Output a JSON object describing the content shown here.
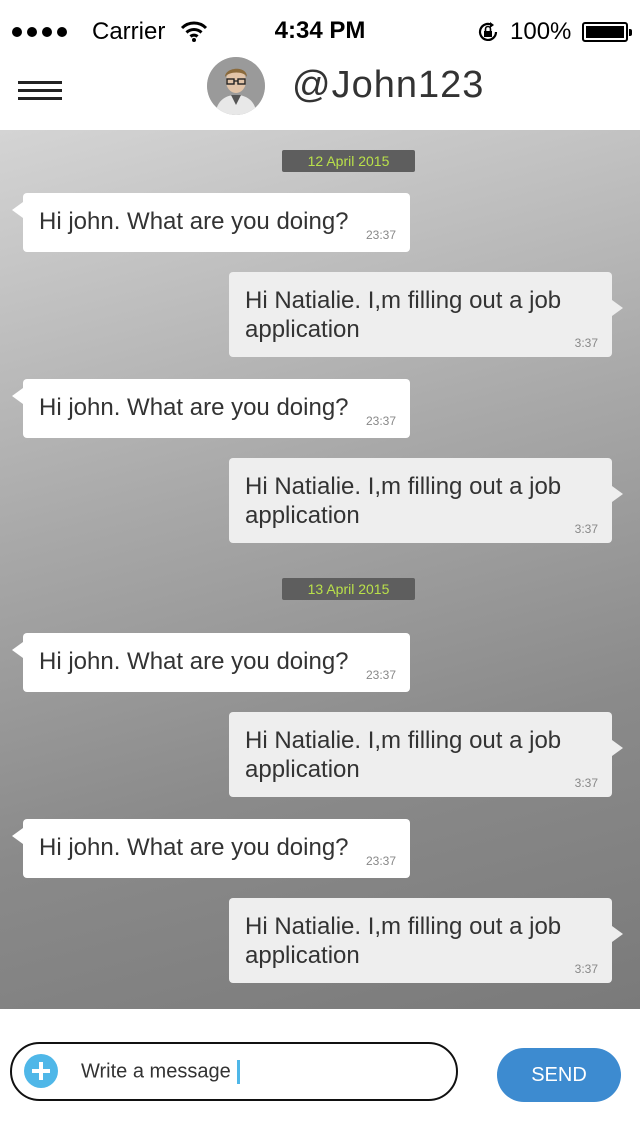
{
  "status_bar": {
    "carrier": "Carrier",
    "time": "4:34 PM",
    "battery": "100%"
  },
  "header": {
    "username": "@John123"
  },
  "dates": [
    "12 April 2015",
    "13 April 2015"
  ],
  "messages": [
    {
      "text": "Hi john. What are you doing?",
      "time": "23:37"
    },
    {
      "text": "Hi Natialie. I,m filling out a job application",
      "time": "3:37"
    },
    {
      "text": "Hi john. What are you doing?",
      "time": "23:37"
    },
    {
      "text": "Hi Natialie. I,m filling out a job application",
      "time": "3:37"
    },
    {
      "text": "Hi john. What are you doing?",
      "time": "23:37"
    },
    {
      "text": "Hi Natialie. I,m filling out a job application",
      "time": "3:37"
    },
    {
      "text": "Hi john. What are you doing?",
      "time": "23:37"
    },
    {
      "text": "Hi Natialie. I,m filling out a job application",
      "time": "3:37"
    }
  ],
  "composer": {
    "placeholder": "Write a message",
    "send_label": "SEND"
  },
  "colors": {
    "accent": "#3d8bd0",
    "plus_icon": "#4fb7e8",
    "date_text": "#b9e04a"
  },
  "icons": [
    "signal-icon",
    "wifi-icon",
    "rotation-lock-icon",
    "battery-icon",
    "hamburger-menu-icon",
    "add-icon"
  ]
}
